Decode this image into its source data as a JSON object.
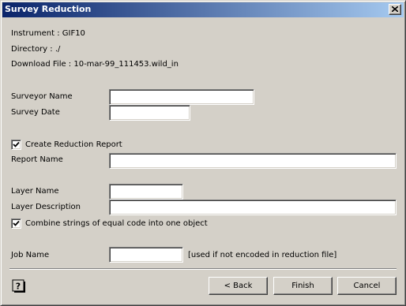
{
  "window": {
    "title": "Survey Reduction"
  },
  "info": {
    "instrument": "Instrument     : GIF10",
    "directory": "Directory       : ./",
    "download_file": "Download File : 10-mar-99_111453.wild_in"
  },
  "form": {
    "surveyor_name": {
      "label": "Surveyor Name",
      "value": ""
    },
    "survey_date": {
      "label": "Survey Date",
      "value": ""
    },
    "create_report": {
      "label": "Create Reduction Report",
      "checked": true
    },
    "report_name": {
      "label": "Report Name",
      "value": ""
    },
    "layer_name": {
      "label": "Layer Name",
      "value": ""
    },
    "layer_description": {
      "label": "Layer Description",
      "value": ""
    },
    "combine_strings": {
      "label": "Combine strings of equal code into one object",
      "checked": true
    },
    "job_name": {
      "label": "Job Name",
      "value": "",
      "hint": "[used if not encoded in reduction file]"
    }
  },
  "buttons": {
    "back": "< Back",
    "finish": "Finish",
    "cancel": "Cancel"
  },
  "icons": {
    "close": "close-icon",
    "help": "help-icon",
    "check": "checkmark-icon"
  },
  "colors": {
    "dialog_bg": "#d4d0c8",
    "title_start": "#0a246a",
    "title_end": "#a6caf0"
  }
}
